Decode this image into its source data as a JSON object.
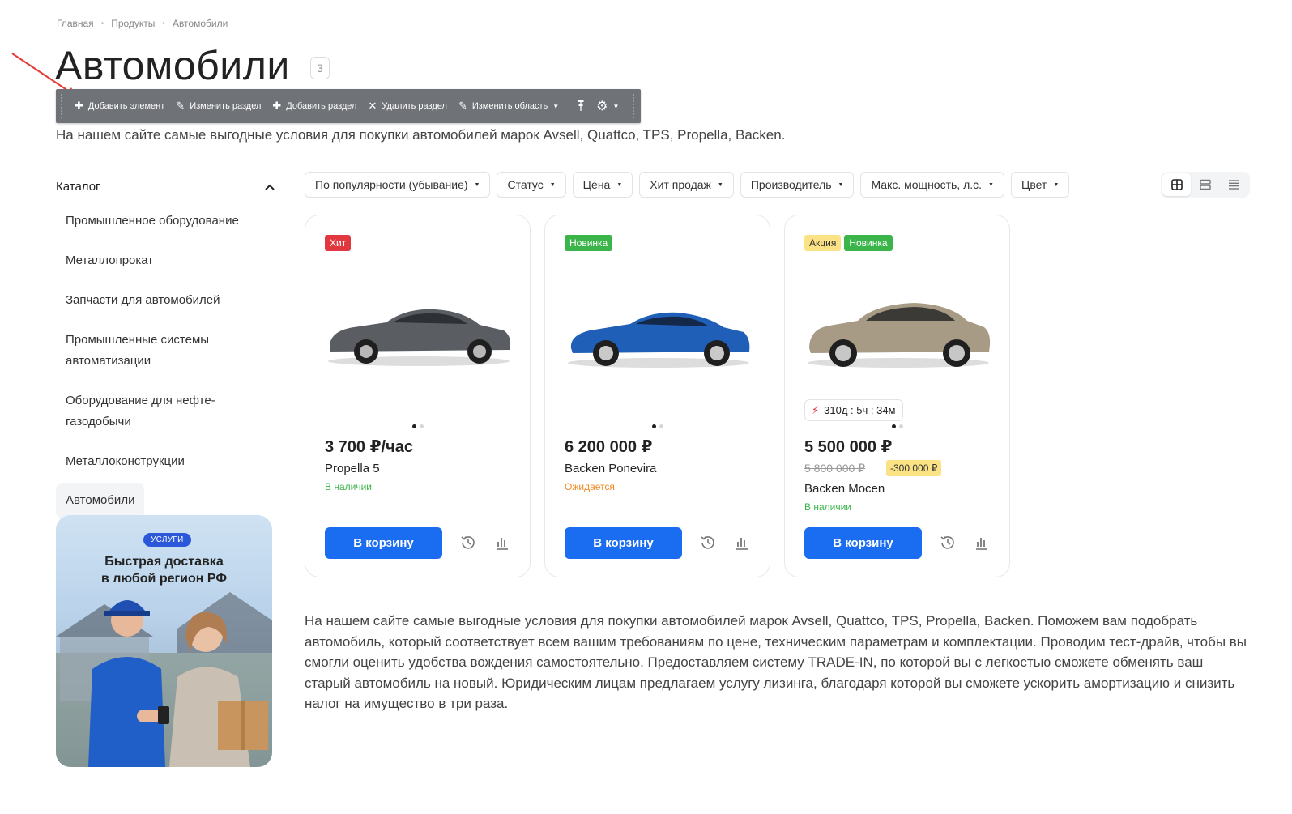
{
  "breadcrumb": [
    "Главная",
    "Продукты",
    "Автомобили"
  ],
  "page": {
    "title": "Автомобили",
    "count": "3",
    "intro": "На нашем сайте самые выгодные условия для покупки автомобилей марок Avsell, Quattco, TPS, Propella, Backen."
  },
  "admin_toolbar": {
    "add_element": "Добавить элемент",
    "edit_section": "Изменить раздел",
    "add_section": "Добавить раздел",
    "delete_section": "Удалить раздел",
    "edit_area": "Изменить область"
  },
  "sidebar": {
    "heading": "Каталог",
    "items": [
      {
        "label": "Промышленное оборудование"
      },
      {
        "label": "Металлопрокат"
      },
      {
        "label": "Запчасти для автомобилей"
      },
      {
        "label": "Промышленные системы автоматизации"
      },
      {
        "label": "Оборудование для нефте-газодобычи"
      },
      {
        "label": "Металлоконструкции"
      },
      {
        "label": "Автомобили"
      }
    ],
    "promo": {
      "chip": "УСЛУГИ",
      "line1": "Быстрая доставка",
      "line2": "в любой регион РФ"
    }
  },
  "filters": [
    "По популярности (убывание)",
    "Статус",
    "Цена",
    "Хит продаж",
    "Производитель",
    "Макс. мощность, л.с.",
    "Цвет"
  ],
  "cards": [
    {
      "badges": [
        "Хит"
      ],
      "price": "3 700 ₽/час",
      "name": "Propella 5",
      "stock": "В наличии",
      "cart": "В корзину",
      "car_color": "#5a5d62"
    },
    {
      "badges": [
        "Новинка"
      ],
      "price": "6 200 000 ₽",
      "name": "Backen Ponevira",
      "stock": "Ожидается",
      "cart": "В корзину",
      "car_color": "#1f5fb8"
    },
    {
      "badges": [
        "Акция",
        "Новинка"
      ],
      "timer": "310д : 5ч : 34м",
      "price": "5 500 000 ₽",
      "old_price": "5 800 000 ₽",
      "discount": "-300 000 ₽",
      "name": "Backen Mocen",
      "stock": "В наличии",
      "cart": "В корзину",
      "car_color": "#a89b86"
    }
  ],
  "seo_text": "На нашем сайте самые выгодные условия для покупки автомобилей марок Avsell, Quattco, TPS, Propella, Backen. Поможем вам подобрать автомобиль, который соответствует всем вашим требованиям по цене, техническим параметрам и комплектации. Проводим тест-драйв, чтобы вы смогли оценить удобства вождения самостоятельно. Предоставляем систему TRADE-IN, по которой вы с легкостью сможете обменять ваш старый автомобиль на новый. Юридическим лицам предлагаем услугу лизинга, благодаря которой вы сможете ускорить амортизацию и снизить налог на имущество в три раза.",
  "colors": {
    "accent": "#1a6cf1",
    "hit": "#e0383e",
    "new": "#3bb54a",
    "sale": "#fbe284",
    "toolbar": "#6f7277"
  }
}
